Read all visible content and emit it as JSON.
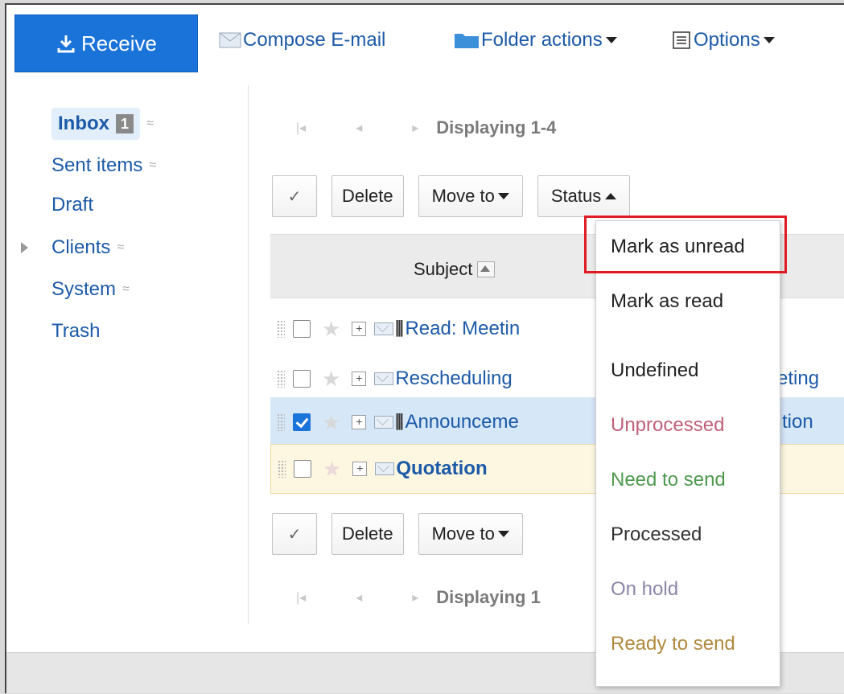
{
  "toolbar": {
    "receive_label": "Receive",
    "compose_label": "Compose E-mail",
    "folder_actions_label": "Folder actions",
    "options_label": "Options"
  },
  "sidebar": {
    "items": [
      {
        "label": "Inbox",
        "badge": "1"
      },
      {
        "label": "Sent items"
      },
      {
        "label": "Draft"
      },
      {
        "label": "Clients"
      },
      {
        "label": "System"
      },
      {
        "label": "Trash"
      }
    ]
  },
  "paging": {
    "top_text": "Displaying 1-4",
    "bottom_text": "Displaying 1"
  },
  "actions": {
    "delete_label": "Delete",
    "move_to_label": "Move to",
    "status_label": "Status"
  },
  "list": {
    "header_subject": "Subject",
    "rows": [
      {
        "subject": "Read: Meetin",
        "checked": false,
        "attachment": true
      },
      {
        "subject": "Rescheduling",
        "tail": "eting",
        "checked": false,
        "attachment": false
      },
      {
        "subject": "Announceme",
        "tail": "tion",
        "checked": true,
        "attachment": true
      },
      {
        "subject": "Quotation",
        "checked": false,
        "attachment": false
      }
    ]
  },
  "status_menu": {
    "items": [
      {
        "label": "Mark as unread",
        "color": "#222222"
      },
      {
        "label": "Mark as read",
        "color": "#222222"
      },
      {
        "label": "Undefined",
        "color": "#222222"
      },
      {
        "label": "Unprocessed",
        "color": "#c0607a"
      },
      {
        "label": "Need to send",
        "color": "#4e9a4e"
      },
      {
        "label": "Processed",
        "color": "#333333"
      },
      {
        "label": "On hold",
        "color": "#8a86a8"
      },
      {
        "label": "Ready to send",
        "color": "#b08a3e"
      }
    ],
    "highlighted_item": "Mark as unread",
    "highlight_color": "#e01b24"
  },
  "colors": {
    "accent": "#1a73d9",
    "link": "#1c5aa8"
  }
}
